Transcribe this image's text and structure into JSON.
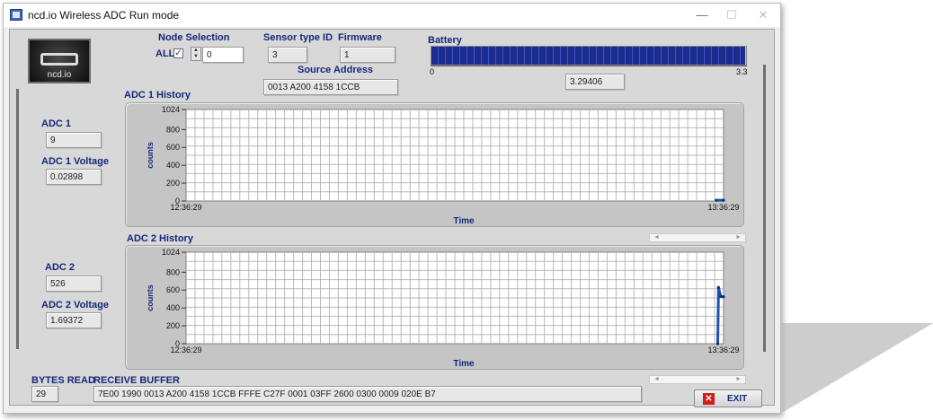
{
  "window": {
    "title": "ncd.io Wireless ADC Run mode",
    "controls": {
      "minimize": "—",
      "maximize": "☐",
      "close": "✕"
    }
  },
  "logo": {
    "text": "ncd.io"
  },
  "node_selection": {
    "label": "Node Selection",
    "all_label": "ALL",
    "all_checked": true,
    "check_glyph": "✓",
    "value": "0"
  },
  "sensor_type": {
    "label": "Sensor type ID",
    "value": "3"
  },
  "firmware": {
    "label": "Firmware",
    "value": "1"
  },
  "source_address": {
    "label": "Source Address",
    "value": "0013 A200 4158 1CCB"
  },
  "battery": {
    "label": "Battery",
    "min_label": "0",
    "max_label": "3.3",
    "value": "3.29406",
    "level": 0.998
  },
  "adc1": {
    "label": "ADC 1",
    "value": "9",
    "voltage_label": "ADC 1 Voltage",
    "voltage_value": "0.02898"
  },
  "adc2": {
    "label": "ADC 2",
    "value": "526",
    "voltage_label": "ADC 2 Voltage",
    "voltage_value": "1.69372"
  },
  "bytes_read": {
    "label": "BYTES READ",
    "value": "29"
  },
  "receive_buffer": {
    "label": "RECEIVE BUFFER",
    "value": "7E00 1990 0013 A200 4158 1CCB FFFE C27F 0001 03FF 2600 0300 0009 020E B7"
  },
  "exit_button": {
    "label": "EXIT",
    "icon": "✕"
  },
  "colors": {
    "label_blue": "#14287a",
    "battery_fill": "#1b2c8c",
    "trace": "#1f4fb0"
  },
  "chart_data": [
    {
      "type": "line",
      "title": "ADC 1 History",
      "xlabel": "Time",
      "ylabel": "counts",
      "ylim": [
        0,
        1024
      ],
      "y_ticks": [
        "1024",
        "800",
        "600",
        "400",
        "200",
        "0"
      ],
      "x_ticks": [
        "12:36:29",
        "13:36:29"
      ],
      "grid": true,
      "series": [
        {
          "x": [
            "13:35:40",
            "13:36:29"
          ],
          "values": [
            9,
            9
          ]
        }
      ]
    },
    {
      "type": "line",
      "title": "ADC 2 History",
      "xlabel": "Time",
      "ylabel": "counts",
      "ylim": [
        0,
        1024
      ],
      "y_ticks": [
        "1024",
        "800",
        "600",
        "400",
        "200",
        "0"
      ],
      "x_ticks": [
        "12:36:29",
        "13:36:29"
      ],
      "grid": true,
      "series": [
        {
          "x": [
            "13:35:50",
            "13:35:55",
            "13:36:10",
            "13:36:29"
          ],
          "values": [
            0,
            630,
            530,
            526
          ]
        }
      ]
    }
  ]
}
